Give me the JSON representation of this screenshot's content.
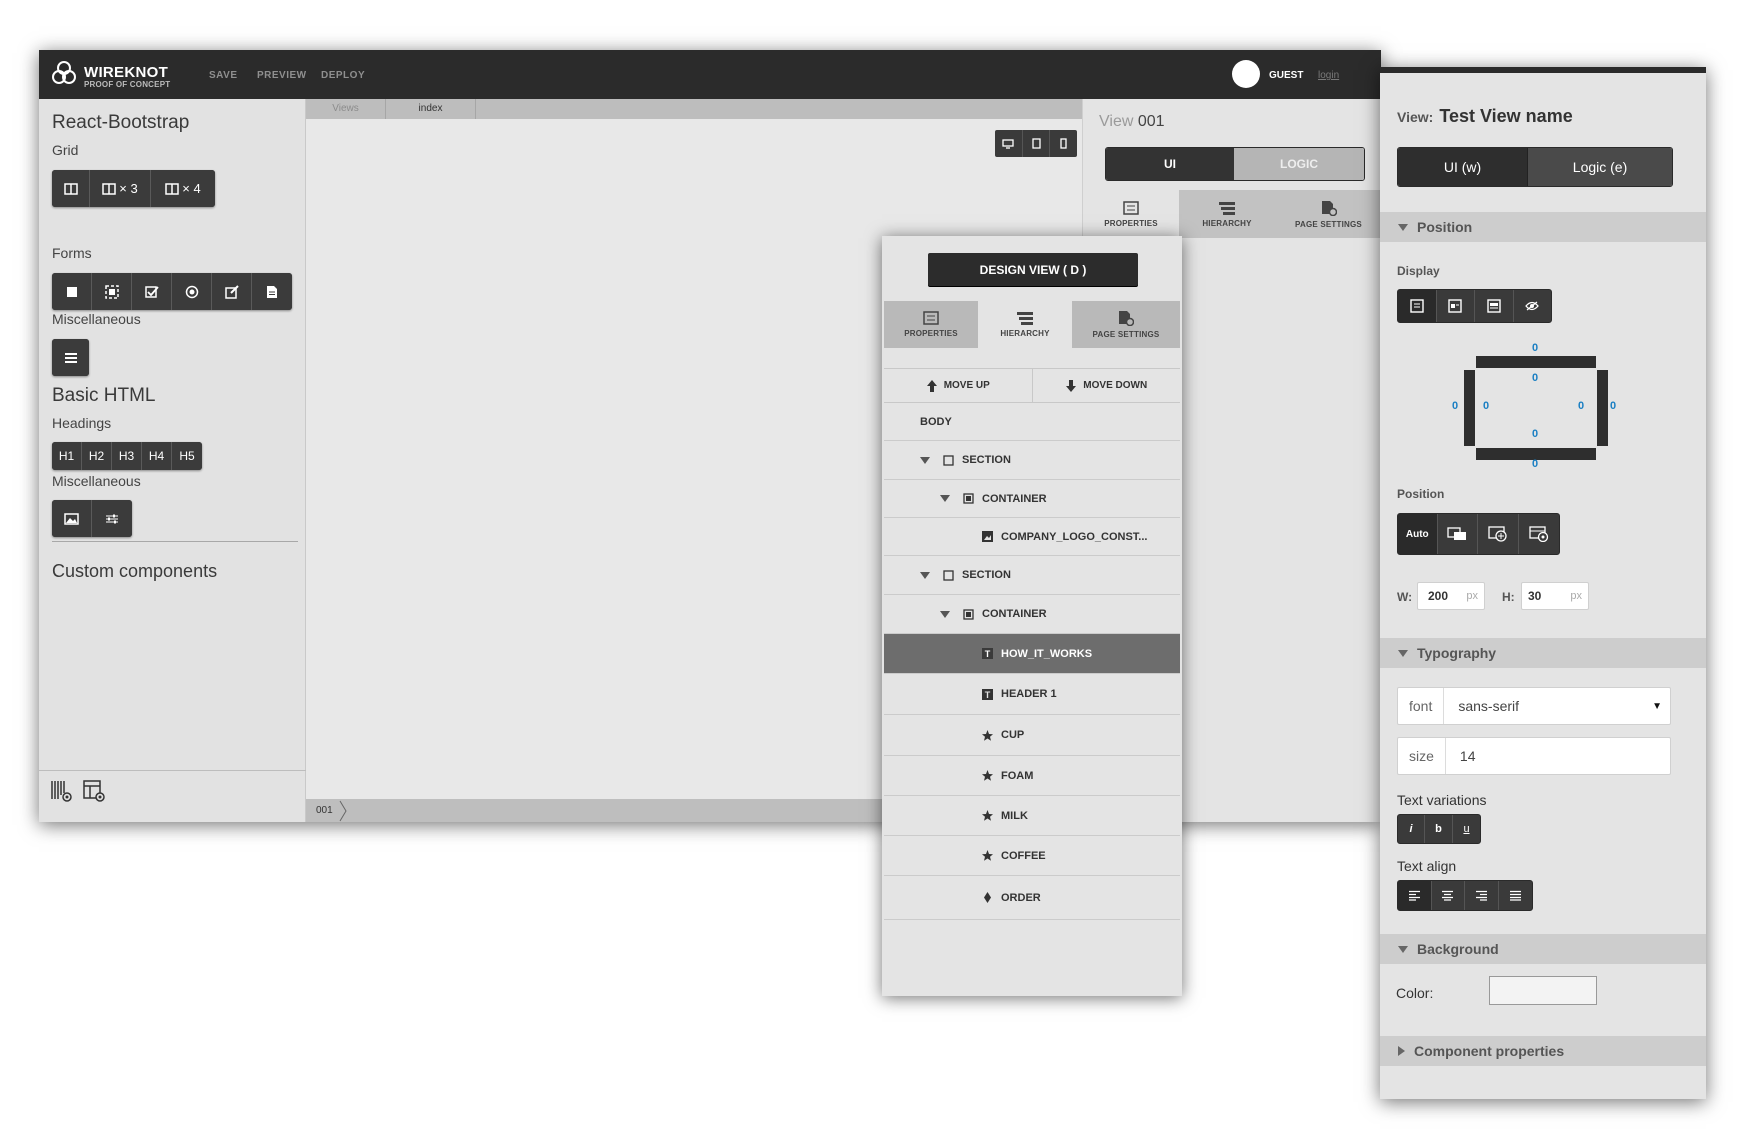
{
  "app": {
    "name": "WIREKNOT",
    "tagline": "PROOF OF CONCEPT",
    "nav": [
      "SAVE",
      "PREVIEW",
      "DEPLOY"
    ],
    "user": "GUEST",
    "login": "login"
  },
  "sidebar": {
    "library_1": "React-Bootstrap",
    "grid_label": "Grid",
    "grid_buttons": [
      "",
      "× 3",
      "× 4"
    ],
    "forms_label": "Forms",
    "misc_label": "Miscellaneous",
    "library_2": "Basic HTML",
    "headings_label": "Headings",
    "headings": [
      "H1",
      "H2",
      "H3",
      "H4",
      "H5"
    ],
    "misc2_label": "Miscellaneous",
    "custom": "Custom components"
  },
  "canvas": {
    "tabs": [
      "Views",
      "index"
    ],
    "breadcrumb": "001"
  },
  "view_panel": {
    "label": "View",
    "id": "001",
    "mode_tabs": [
      "UI",
      "LOGIC"
    ],
    "sub_tabs": [
      "PROPERTIES",
      "HIERARCHY",
      "PAGE SETTINGS"
    ]
  },
  "hierarchy": {
    "design_button": "DESIGN VIEW ( D )",
    "tabs": [
      "PROPERTIES",
      "HIERARCHY",
      "PAGE SETTINGS"
    ],
    "move_up": "MOVE UP",
    "move_down": "MOVE DOWN",
    "nodes": [
      {
        "label": "BODY",
        "icon": "none"
      },
      {
        "label": "SECTION",
        "icon": "square-outline-icon"
      },
      {
        "label": "CONTAINER",
        "icon": "square-filled-icon"
      },
      {
        "label": "COMPANY_LOGO_CONST...",
        "icon": "image-icon"
      },
      {
        "label": "SECTION",
        "icon": "square-outline-icon"
      },
      {
        "label": "CONTAINER",
        "icon": "square-filled-icon"
      },
      {
        "label": "HOW_IT_WORKS",
        "icon": "text-icon"
      },
      {
        "label": "HEADER 1",
        "icon": "text-icon"
      },
      {
        "label": "CUP",
        "icon": "star-icon"
      },
      {
        "label": "FOAM",
        "icon": "star-icon"
      },
      {
        "label": "MILK",
        "icon": "star-icon"
      },
      {
        "label": "COFFEE",
        "icon": "star-icon"
      },
      {
        "label": "ORDER",
        "icon": "diamond-icon"
      }
    ]
  },
  "properties": {
    "view_label": "View:",
    "view_name": "Test View name",
    "mode_tabs": [
      "UI (w)",
      "Logic (e)"
    ],
    "position_section": "Position",
    "display_label": "Display",
    "box_values": [
      "0",
      "0",
      "0",
      "0",
      "0",
      "0",
      "0",
      "0"
    ],
    "position_label": "Position",
    "position_auto": "Auto",
    "w_label": "W:",
    "w_value": "200",
    "h_label": "H:",
    "h_value": "30",
    "unit": "px",
    "typography_section": "Typography",
    "font_label": "font",
    "font_value": "sans-serif",
    "size_label": "size",
    "size_value": "14",
    "text_variations": "Text variations",
    "variation_buttons": [
      "i",
      "b",
      "u"
    ],
    "text_align": "Text align",
    "background_section": "Background",
    "color_label": "Color:",
    "component_section": "Component properties"
  },
  "colors": {
    "topbar": "#2b2b2b",
    "accent_blue": "#1a7fc3",
    "selected_row": "#6d6d6d"
  }
}
